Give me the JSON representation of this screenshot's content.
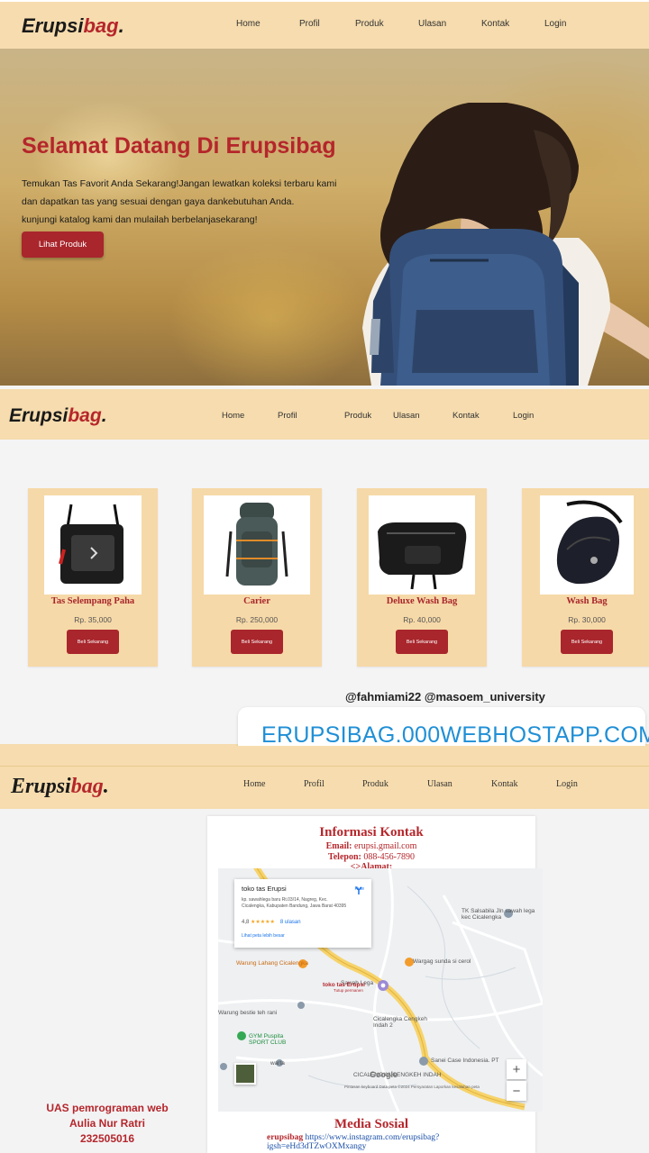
{
  "brand": {
    "main": "Erupsi",
    "accent": "bag",
    "dot": "."
  },
  "nav": {
    "items": [
      "Home",
      "Profil",
      "Produk",
      "Ulasan",
      "Kontak",
      "Login"
    ]
  },
  "hero": {
    "title": "Selamat Datang Di Erupsibag",
    "lines": [
      "Temukan Tas Favorit Anda Sekarang!Jangan lewatkan koleksi terbaru kami",
      "dan dapatkan tas yang sesuai dengan gaya dankebutuhan Anda.",
      "kunjungi katalog kami dan mulailah berbelanjasekarang!"
    ],
    "button": "Lihat Produk"
  },
  "products": [
    {
      "name": "Tas Selempang Paha",
      "price": "Rp. 35,000",
      "button": "Beli Sekarang",
      "icon": "thigh-bag-image"
    },
    {
      "name": "Carier",
      "price": "Rp. 250,000",
      "button": "Beli Sekarang",
      "icon": "backpack-image"
    },
    {
      "name": "Deluxe Wash Bag",
      "price": "Rp. 40,000",
      "button": "Beli Sekarang",
      "icon": "wash-bag-image"
    },
    {
      "name": "Wash Bag",
      "price": "Rp. 30,000",
      "button": "Beli Sekarang",
      "icon": "waist-bag-image"
    }
  ],
  "overlay": {
    "handles": "@fahmiami22 @masoem_university",
    "url": "ERUPSIBAG.000WEBHOSTAPP.COM"
  },
  "contact": {
    "title": "Informasi Kontak",
    "email_label": "Email:",
    "email": "erupsi.gmail.com",
    "phone_label": "Telepon:",
    "phone": "088-456-7890",
    "address_label": "<>Alamat:"
  },
  "map": {
    "place_name": "toko tas Erupsi",
    "place_address": "kp. sawahlega baru Rt.03/14, Nagreg, Kec. Cicalengka, Kabupaten Bandung, Jawa Barat 40395",
    "rating": "4,8",
    "stars": "★★★★★",
    "reviews": "8 ulasan",
    "bigger_map": "Lihat peta lebih besar",
    "route": "Rute",
    "pin_label": "toko tas Erupsi",
    "pin_sub": "Tutup permanen",
    "labels": [
      "Wargag sunda si cerol",
      "Warung Lahang Cicalengka",
      "Warung bestie teh rani",
      "GYM Puspita SPORT CLUB",
      "warta",
      "Cicalengka Cengkeh Indah 2",
      "CICALENGKA CENGKEH INDAH",
      "TK Salsabila Jln sawah lega kec Cicalengka",
      "Sanei Case Indonesia. PT",
      "Sawah Lega"
    ],
    "google": "Google",
    "footer": "Pintasan keyboard   Data peta ©2024   Persyaratan   Laporkan kesalahan peta"
  },
  "social": {
    "title": "Media Sosial",
    "label": "erupsibag",
    "link": "https://www.instagram.com/erupsibag?igsh=eHd3dTZwOXMxangy"
  },
  "credits": {
    "line1": "UAS pemrograman web",
    "line2": "Aulia Nur Ratri",
    "line3": "232505016"
  },
  "colors": {
    "accent": "#b5262b",
    "nav_bg": "#f6dcae",
    "card_bg": "#f6d9a8",
    "link": "#1f8fd6"
  }
}
